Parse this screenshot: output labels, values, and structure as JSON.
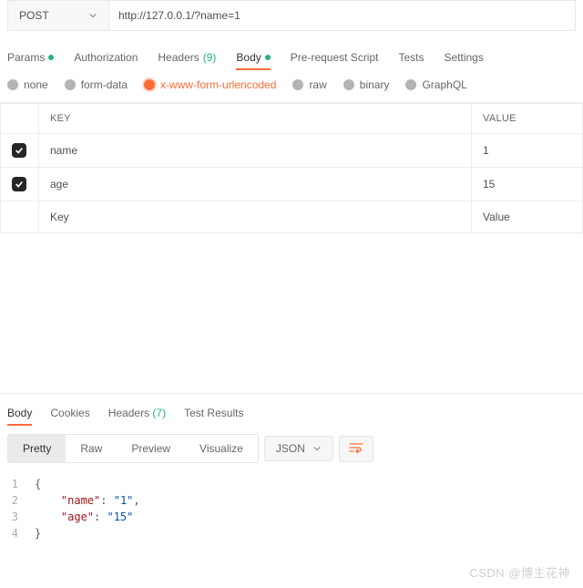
{
  "request": {
    "method": "POST",
    "url": "http://127.0.0.1/?name=1"
  },
  "tabs": [
    {
      "label": "Params",
      "dot": true
    },
    {
      "label": "Authorization"
    },
    {
      "label": "Headers",
      "count": "(9)"
    },
    {
      "label": "Body",
      "dot": true,
      "active": true
    },
    {
      "label": "Pre-request Script"
    },
    {
      "label": "Tests"
    },
    {
      "label": "Settings"
    }
  ],
  "body_types": [
    {
      "label": "none"
    },
    {
      "label": "form-data"
    },
    {
      "label": "x-www-form-urlencoded",
      "selected": true
    },
    {
      "label": "raw"
    },
    {
      "label": "binary"
    },
    {
      "label": "GraphQL"
    }
  ],
  "table": {
    "headers": {
      "key": "KEY",
      "value": "VALUE"
    },
    "rows": [
      {
        "checked": true,
        "key": "name",
        "value": "1"
      },
      {
        "checked": true,
        "key": "age",
        "value": "15"
      }
    ],
    "placeholder": {
      "key": "Key",
      "value": "Value"
    }
  },
  "response": {
    "tabs": [
      {
        "label": "Body",
        "active": true
      },
      {
        "label": "Cookies"
      },
      {
        "label": "Headers",
        "count": "(7)"
      },
      {
        "label": "Test Results"
      }
    ],
    "views": [
      {
        "label": "Pretty",
        "active": true
      },
      {
        "label": "Raw"
      },
      {
        "label": "Preview"
      },
      {
        "label": "Visualize"
      }
    ],
    "format": "JSON",
    "code_lines": [
      {
        "n": "1",
        "html": "<span class='brace'>{</span>"
      },
      {
        "n": "2",
        "html": "&nbsp;&nbsp;&nbsp;&nbsp;<span class='json-key'>\"name\"</span>: <span class='json-str'>\"1\"</span>,"
      },
      {
        "n": "3",
        "html": "&nbsp;&nbsp;&nbsp;&nbsp;<span class='json-key'>\"age\"</span>: <span class='json-str'>\"15\"</span>"
      },
      {
        "n": "4",
        "html": "<span class='brace'>}</span>"
      }
    ]
  },
  "watermark": "CSDN @博主花神"
}
